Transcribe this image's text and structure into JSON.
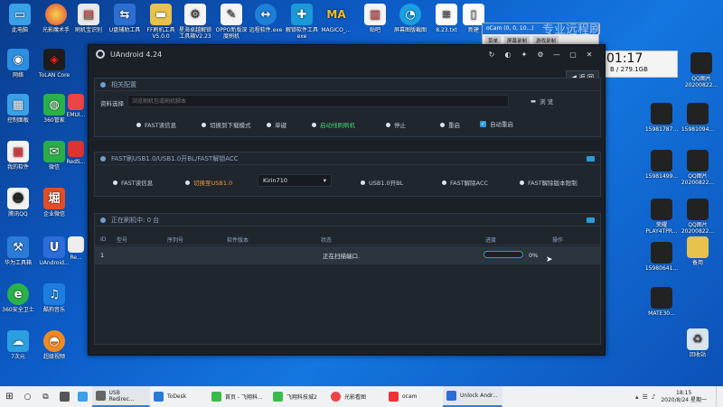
{
  "desktop": {
    "icons_top": [
      "此电脑",
      "光影魔术手",
      "刷机宝识别",
      "U盘辅助工具",
      "FF刷机工具V5.0.0",
      "星海卓越解锁工具箱V2.23",
      "OPPO新版深度刷机",
      "远程软件.exe",
      "解锁软件工具exe",
      "MAGICO_...",
      "贴吧",
      "屏幕图版截图",
      "8.23.txt",
      "新建"
    ],
    "icons_left": [
      "网络",
      "ToLAN Core",
      "控制面板",
      "360管家",
      "我的软件",
      "微信",
      "腾讯QQ",
      "企业微信",
      "华为工具箱",
      "UAndroid...",
      "360安全卫士",
      "酷狗音乐",
      "7次元"
    ],
    "icons_left2": [
      "超级视频",
      "EMUI...",
      "RedS...",
      "Re..."
    ],
    "icons_right": [
      "15981787...",
      "15981094...",
      "15981499...",
      "QQ图片20200822...",
      "QQ图片20200822...",
      "荣耀PLAY4TPR...",
      "QQ图片20200822...",
      "15980641...",
      "备用",
      "MATE30...",
      "回收站"
    ],
    "icons_right_col2": [
      "QQ图片20200822...",
      "QQ图片20200822..."
    ]
  },
  "ocam": {
    "title": "oCam (0, 0, 10...)",
    "menu": [
      "菜单",
      "屏幕录制",
      "游戏录制"
    ],
    "label": "专业远程刷"
  },
  "clock_widget": {
    "time": "01:17",
    "storage": "B / 279.1GB"
  },
  "app": {
    "title": "UAndroid 4.24",
    "back_label": "返 回",
    "panel1": {
      "header": "相关配置",
      "file_label": "资料选择",
      "file_placeholder": "浏览刷机包或刷机脚本",
      "browse_label": "浏 览",
      "options": [
        {
          "label": "FAST读信息",
          "style": "normal"
        },
        {
          "label": "切换到下载模式",
          "style": "normal"
        },
        {
          "label": "单键",
          "style": "normal"
        },
        {
          "label": "启动线刷刷机",
          "style": "green"
        },
        {
          "label": "停止",
          "style": "normal"
        },
        {
          "label": "重启",
          "style": "normal"
        }
      ],
      "checkbox_label": "自动重启"
    },
    "panel2": {
      "header": "FAST刷USB1.0/USB1.0开BL/FAST解锁ACC",
      "buttons": [
        "FAST读信息",
        "切换至USB1.0",
        "USB1.0开BL",
        "FAST解除ACC",
        "FAST解除版本限制"
      ],
      "select_value": "Kirin710"
    },
    "panel3": {
      "header": "正在刷机中: 0 台",
      "columns": [
        "ID",
        "型号",
        "序列号",
        "软件版本",
        "状态",
        "进度",
        "操作"
      ],
      "rows": [
        {
          "id": "1",
          "model": "",
          "serial": "",
          "version": "",
          "status": "正在扫描端口.",
          "progress": "0%",
          "progress_value": 0
        }
      ]
    }
  },
  "taskbar": {
    "search_label": "",
    "items": [
      "USB Redirec...",
      "ToDesk",
      "首页 - 飞翔科...",
      "飞翔科技城2",
      "光影看图",
      "ocam",
      "Unlock Andr..."
    ],
    "time": "18:15",
    "date": "2020/8/24 星期一"
  },
  "colors": {
    "accent": "#2e9bd6",
    "green": "#3bd16f",
    "orange": "#e99a3a",
    "panel_bg": "#20262e"
  }
}
